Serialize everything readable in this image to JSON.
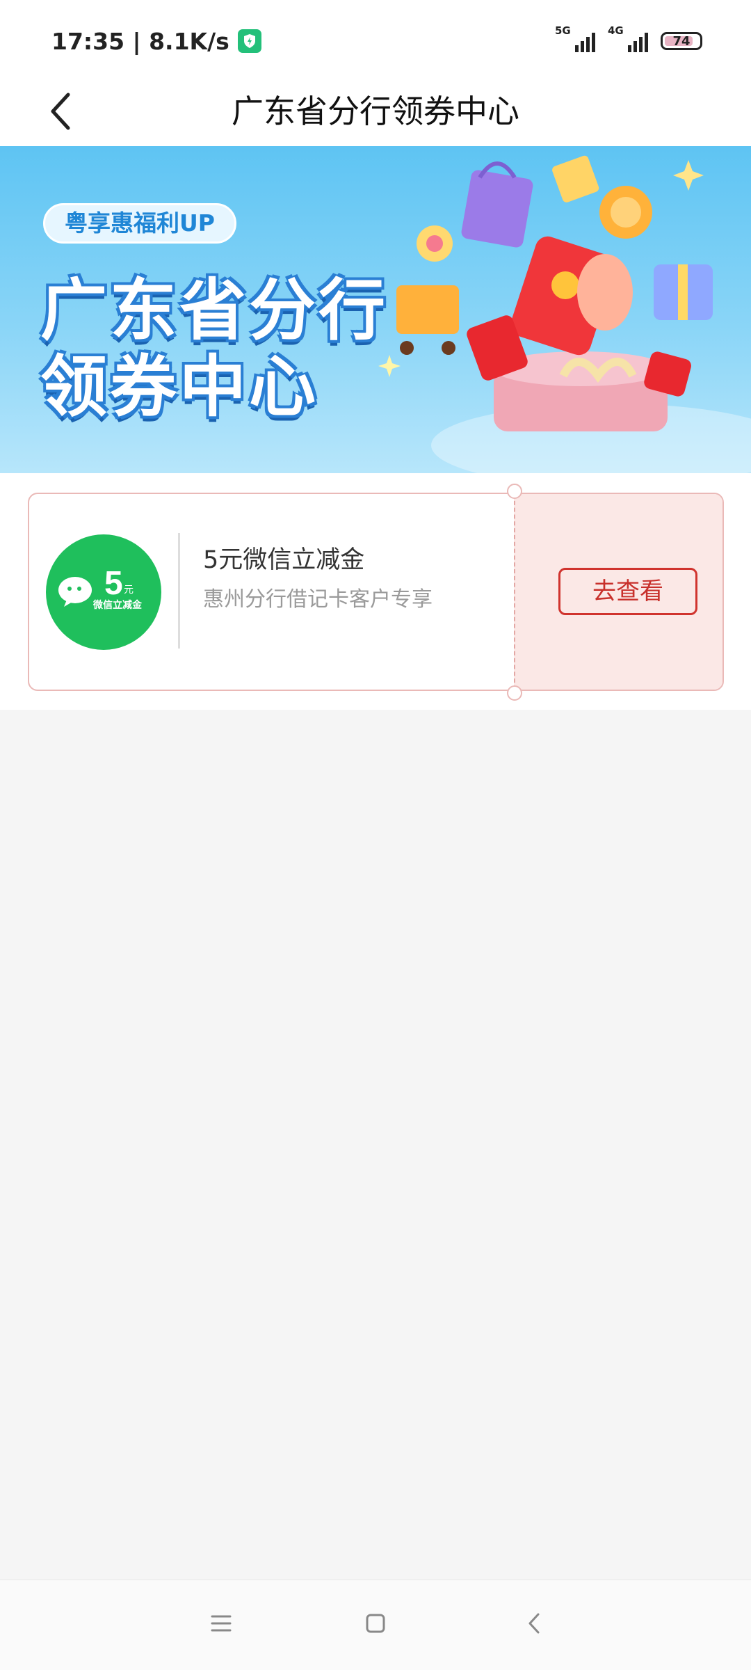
{
  "status_bar": {
    "time_speed": "17:35 | 8.1K/s",
    "signal1_label": "5G",
    "signal2_label": "4G",
    "battery": "74"
  },
  "header": {
    "title": "广东省分行领券中心"
  },
  "banner": {
    "tag": "粤享惠福利UP",
    "line1": "广东省分行",
    "line2": "领券中心"
  },
  "coupon": {
    "logo_amount": "5",
    "logo_unit": "元",
    "logo_caption": "微信立减金",
    "title": "5元微信立减金",
    "description": "惠州分行借记卡客户专享",
    "button_label": "去查看"
  },
  "colors": {
    "brand_green": "#1fbf5c",
    "accent_red": "#d0332e",
    "coupon_bg": "#fbe8e6",
    "banner_blue": "#5ec4f3"
  }
}
